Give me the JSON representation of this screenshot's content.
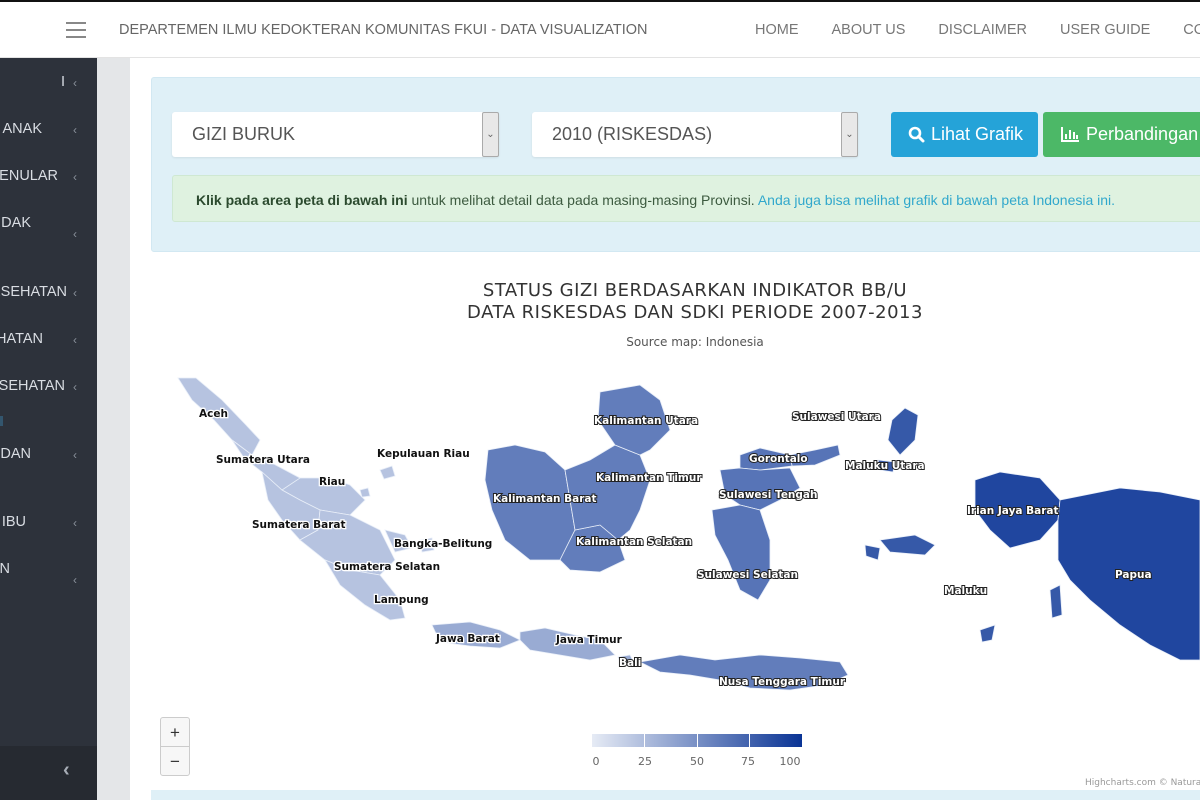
{
  "header": {
    "brand": "DEPARTEMEN ILMU KEDOKTERAN KOMUNITAS FKUI - DATA VISUALIZATION",
    "nav": [
      "HOME",
      "ABOUT US",
      "DISCLAIMER",
      "USER GUIDE",
      "CONTA"
    ]
  },
  "sidebar": {
    "items": [
      {
        "label": "I"
      },
      {
        "label": "ANAK"
      },
      {
        "label": "MENULAR"
      },
      {
        "label": "IDAK"
      },
      {
        "label": "ESEHATAN"
      },
      {
        "label": "HATAN"
      },
      {
        "label": "ESEHATAN"
      },
      {
        "label": "DAN"
      },
      {
        "label": "IBU"
      },
      {
        "label": "N"
      }
    ],
    "collapse_icon": "chevron-left-icon"
  },
  "filters": {
    "indicator_value": "GIZI BURUK",
    "year_value": "2010 (RISKESDAS)",
    "view_chart_label": "Lihat Grafik",
    "compare_label": "Perbandingan"
  },
  "alert": {
    "bold": "Klik pada area peta di bawah ini",
    "text": " untuk melihat detail data pada masing-masing Provinsi. ",
    "info": "Anda juga bisa melihat grafik di bawah peta Indonesia ini."
  },
  "map": {
    "title_line1": "STATUS GIZI BERDASARKAN INDIKATOR BB/U",
    "title_line2": "DATA RISKESDAS DAN SDKI PERIODE 2007-2013",
    "subtitle": "Source map: Indonesia",
    "zoom_in": "+",
    "zoom_out": "−",
    "credits": "Highcharts.com © Natura",
    "colors": {
      "min": "#e6ebf5",
      "max": "#0a3495"
    },
    "legend": {
      "min": 0,
      "max": 100,
      "ticks": [
        "0",
        "25",
        "50",
        "75",
        "100"
      ]
    },
    "regions": [
      {
        "name": "Aceh",
        "level": 0.22
      },
      {
        "name": "Sumatera Utara",
        "level": 0.22
      },
      {
        "name": "Riau",
        "level": 0.22
      },
      {
        "name": "Kepulauan Riau",
        "level": 0.22
      },
      {
        "name": "Sumatera Barat",
        "level": 0.22
      },
      {
        "name": "Bangka-Belitung",
        "level": 0.22
      },
      {
        "name": "Sumatera Selatan",
        "level": 0.22
      },
      {
        "name": "Lampung",
        "level": 0.22
      },
      {
        "name": "Jawa Barat",
        "level": 0.35
      },
      {
        "name": "Jawa Timur",
        "level": 0.35
      },
      {
        "name": "Bali",
        "level": 0.35
      },
      {
        "name": "Kalimantan Utara",
        "level": 0.6
      },
      {
        "name": "Kalimantan Timur",
        "level": 0.6
      },
      {
        "name": "Kalimantan Barat",
        "level": 0.6
      },
      {
        "name": "Kalimantan Selatan",
        "level": 0.6
      },
      {
        "name": "Sulawesi Utara",
        "level": 0.65
      },
      {
        "name": "Gorontalo",
        "level": 0.65
      },
      {
        "name": "Sulawesi Tengah",
        "level": 0.65
      },
      {
        "name": "Sulawesi Selatan",
        "level": 0.65
      },
      {
        "name": "Maluku Utara",
        "level": 0.8
      },
      {
        "name": "Irian Jaya Barat",
        "level": 0.9
      },
      {
        "name": "Maluku",
        "level": 0.8
      },
      {
        "name": "Papua",
        "level": 0.9
      },
      {
        "name": "Nusa Tenggara Timur",
        "level": 0.6
      }
    ]
  }
}
